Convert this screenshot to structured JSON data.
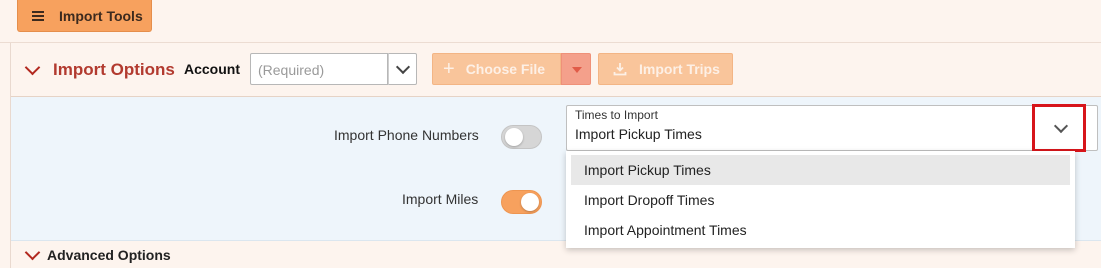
{
  "toolbar": {
    "import_tools_label": "Import Tools"
  },
  "import_options": {
    "title": "Import Options",
    "account_label": "Account",
    "account_placeholder": "(Required)",
    "choose_file_label": "Choose File",
    "import_trips_label": "Import Trips"
  },
  "options": {
    "phone_label": "Import Phone Numbers",
    "phone_on": false,
    "miles_label": "Import Miles",
    "miles_on": true
  },
  "times": {
    "caption": "Times to Import",
    "value": "Import Pickup Times",
    "options": [
      "Import Pickup Times",
      "Import Dropoff Times",
      "Import Appointment Times"
    ]
  },
  "advanced": {
    "title": "Advanced Options"
  },
  "colors": {
    "accent": "#f7a15e",
    "title_red": "#b23a2f",
    "highlight": "#d7151b"
  },
  "icons": {
    "menu": "hamburger-icon",
    "add": "plus-icon",
    "import": "import-icon",
    "expand": "chevron-down-icon"
  }
}
